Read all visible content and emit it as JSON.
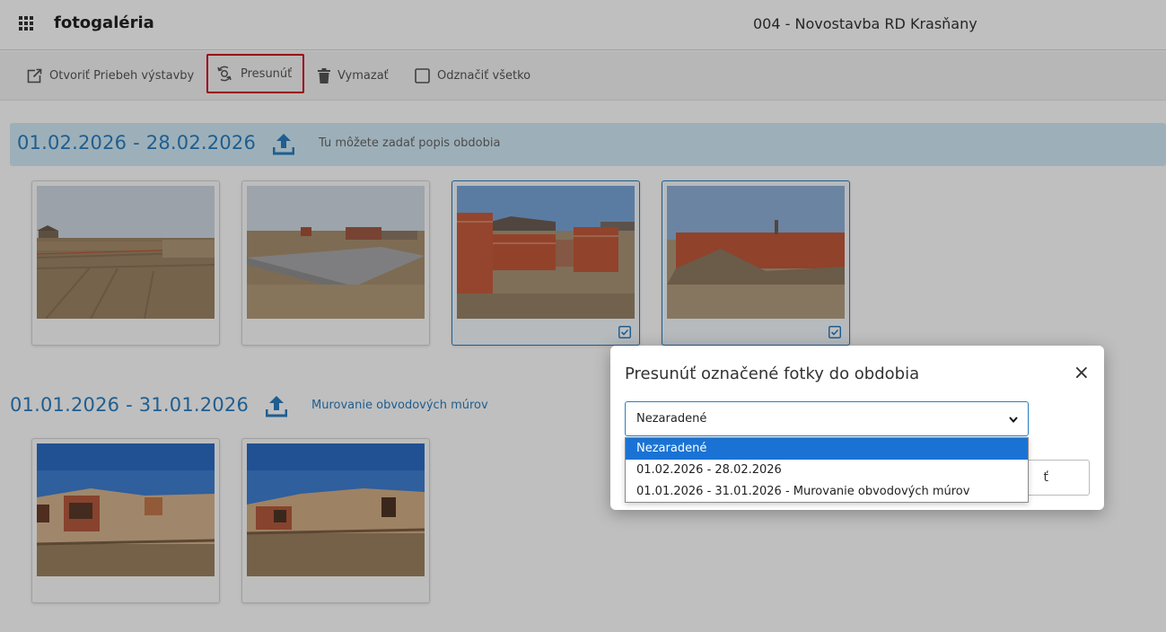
{
  "header": {
    "app_title": "fotogaléria",
    "project_title": "004 - Novostavba RD Krasňany"
  },
  "toolbar": {
    "open_label": "Otvoriť Priebeh výstavby",
    "move_label": "Presunúť",
    "delete_label": "Vymazať",
    "unselect_label": "Odznačiť všetko"
  },
  "periods": [
    {
      "title": "01.02.2026 - 28.02.2026",
      "description_placeholder": "Tu môžete zadať popis obdobia",
      "photos": [
        {
          "selected": false,
          "scene": "site-ground"
        },
        {
          "selected": false,
          "scene": "foundation-slab"
        },
        {
          "selected": true,
          "scene": "brick-walls"
        },
        {
          "selected": true,
          "scene": "brick-walls-far"
        }
      ]
    },
    {
      "title": "01.01.2026 - 31.01.2026",
      "description": "Murovanie obvodových múrov",
      "photos": [
        {
          "selected": false,
          "scene": "house-walls"
        },
        {
          "selected": false,
          "scene": "house-walls-2"
        }
      ]
    }
  ],
  "modal": {
    "title": "Presunúť označené fotky do obdobia",
    "close_symbol": "×",
    "select_value": "Nezaradené",
    "confirm_label_fragment": "ť",
    "options": [
      "Nezaradené",
      "01.02.2026 - 28.02.2026",
      "01.01.2026 - 31.01.2026 - Murovanie obvodových múrov"
    ],
    "active_option_index": 0
  },
  "colors": {
    "accent": "#2a7ec1",
    "period_bar": "#d2ebf7",
    "highlight_border": "#d0021b",
    "dropdown_active": "#1a73d4"
  },
  "icons": [
    "grid-icon",
    "external-link-icon",
    "move-icon",
    "trash-icon",
    "checkbox-icon",
    "upload-icon",
    "checked-icon",
    "close-icon",
    "chevron-down-icon"
  ]
}
